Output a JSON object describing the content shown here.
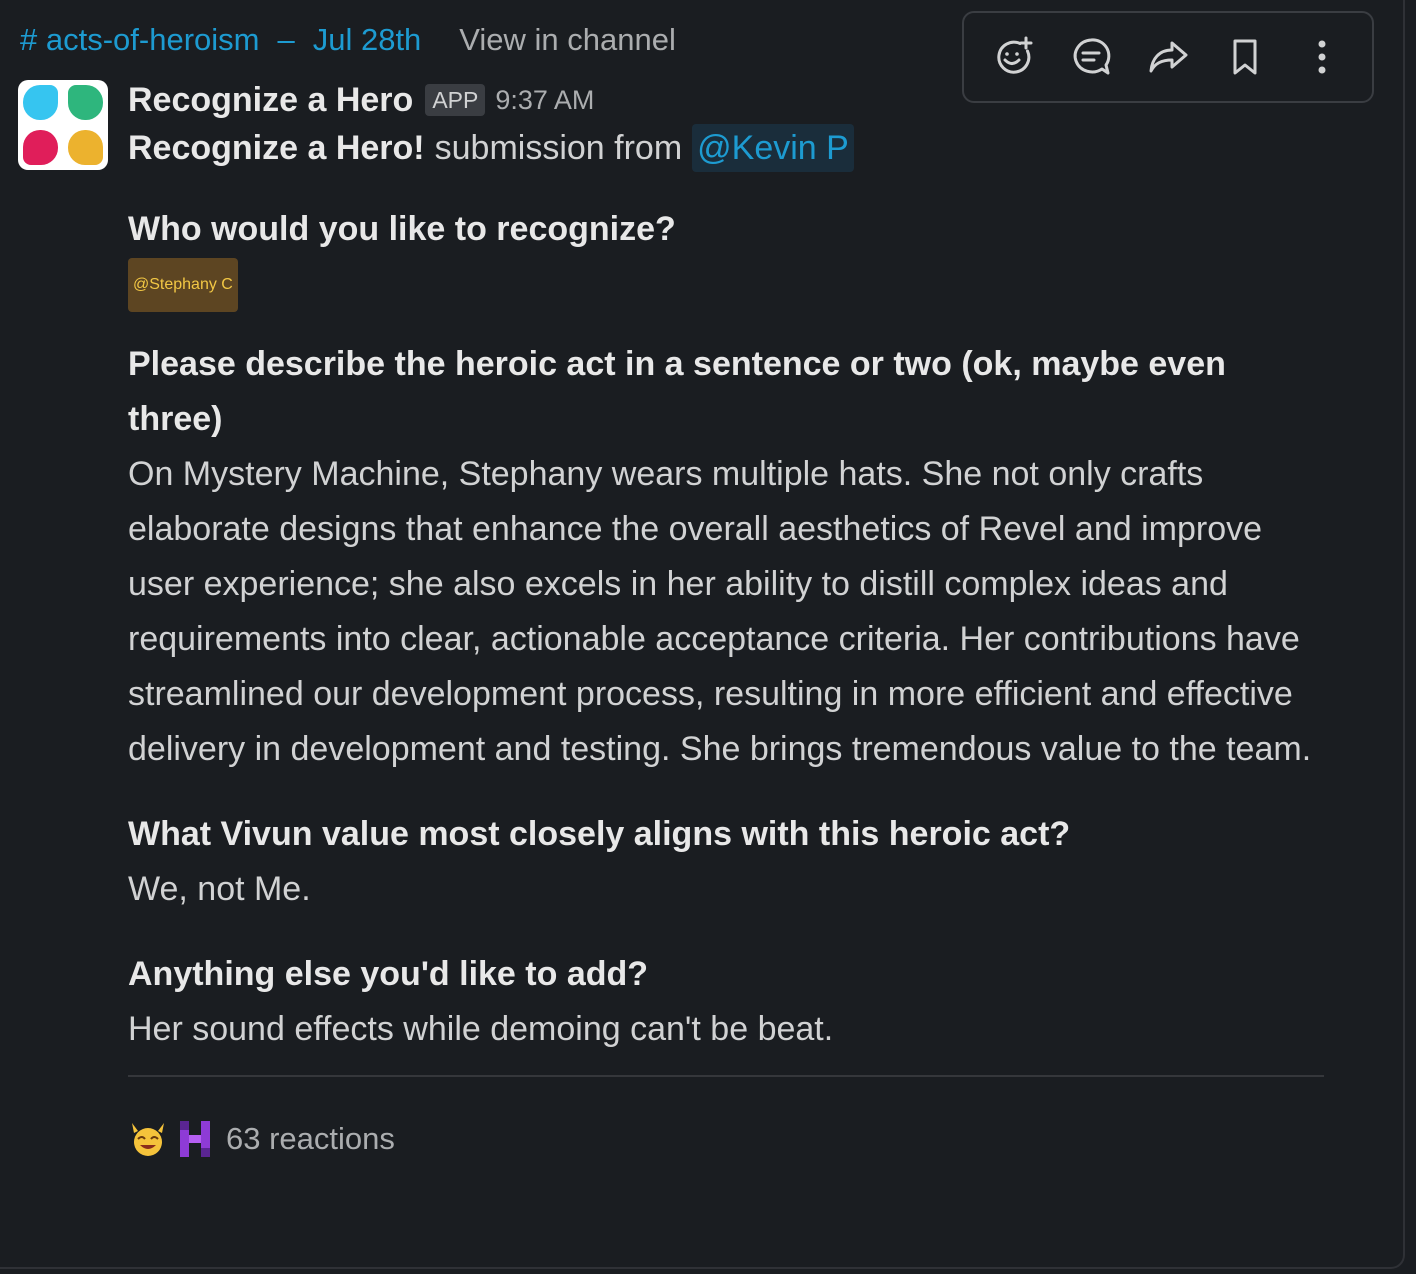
{
  "header": {
    "channel": "# acts-of-heroism",
    "separator": "–",
    "date": "Jul 28th",
    "view_link": "View in channel"
  },
  "toolbar": {
    "buttons": [
      {
        "icon": "add-reaction-icon"
      },
      {
        "icon": "reply-in-thread-icon"
      },
      {
        "icon": "share-icon"
      },
      {
        "icon": "bookmark-icon"
      },
      {
        "icon": "more-actions-icon"
      }
    ],
    "icon_color": "#d1d2d3"
  },
  "message": {
    "avatar_colors": [
      "#36c5f0",
      "#2eb67d",
      "#e01e5a",
      "#ecb22e"
    ],
    "sender": "Recognize a Hero",
    "badge": "APP",
    "time": "9:37 AM",
    "subline_strong": "Recognize a Hero!",
    "subline_text": "submission from",
    "submitter_mention": "@Kevin P",
    "sections": {
      "who": {
        "question": "Who would you like to recognize?",
        "mention": "@Stephany C"
      },
      "describe": {
        "question": "Please describe the heroic act in a sentence or two (ok, maybe even three)",
        "answer": "On Mystery Machine, Stephany wears multiple hats. She not only crafts elaborate designs that enhance the overall aesthetics of Revel and improve user experience; she also excels in her ability to distill complex ideas and requirements into clear, actionable acceptance criteria. Her contributions have streamlined our development process, resulting in more efficient and effective delivery in development and testing. She brings tremendous value to the team."
      },
      "value": {
        "question": "What Vivun value most closely aligns with this heroic act?",
        "answer": "We, not Me."
      },
      "extra": {
        "question": "Anything else you'd like to add?",
        "answer": "Her sound effects while demoing can't be beat."
      }
    },
    "reactions": {
      "emojis": [
        "raised-hands-emoji",
        "hero-h-emoji"
      ],
      "count_text": "63 reactions"
    }
  },
  "colors": {
    "background": "#1a1d21",
    "link_blue": "#1d9bd1",
    "mention_yellow": "#f2c744",
    "mention_yellow_bg": "#5d4522"
  }
}
